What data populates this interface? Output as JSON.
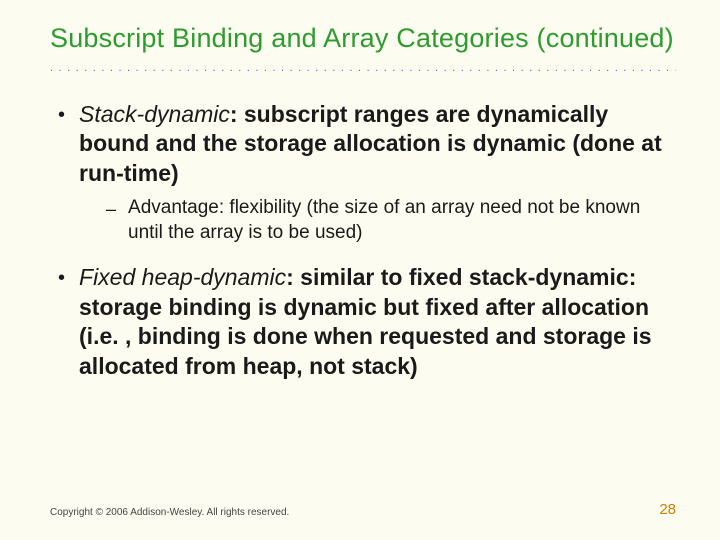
{
  "title": "Subscript Binding and Array Categories (continued)",
  "dot_row": "................................................................................",
  "bullets": [
    {
      "term": "Stack-dynamic",
      "rest": ": subscript ranges are dynamically bound and the storage allocation is dynamic (done at run-time)",
      "sub": [
        "Advantage: flexibility (the size of an array need not be known until the array is to be used)"
      ]
    },
    {
      "term": "Fixed heap-dynamic",
      "rest": ": similar to fixed stack-dynamic: storage binding is dynamic but fixed after allocation (i.e. , binding is done when requested and storage is allocated from heap, not stack)",
      "sub": []
    }
  ],
  "footer": {
    "copyright": "Copyright © 2006 Addison-Wesley. All rights reserved.",
    "page": "28"
  },
  "marks": {
    "l1": "•",
    "l2": "–"
  }
}
